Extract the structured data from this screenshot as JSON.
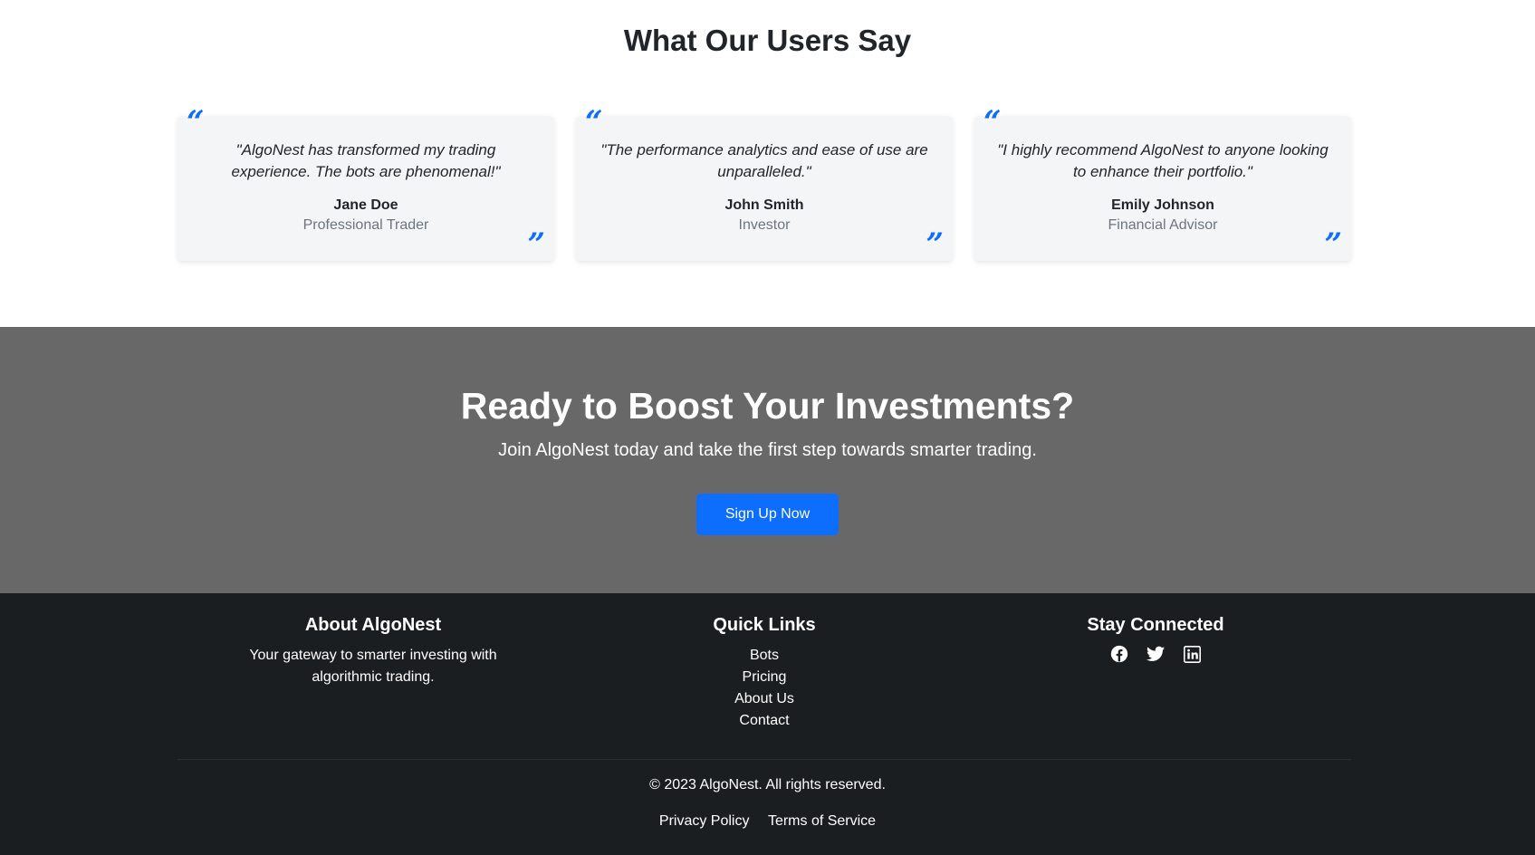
{
  "testimonials": {
    "title": "What Our Users Say",
    "items": [
      {
        "quote": "\"AlgoNest has transformed my trading experience. The bots are phenomenal!\"",
        "name": "Jane Doe",
        "role": "Professional Trader"
      },
      {
        "quote": "\"The performance analytics and ease of use are unparalleled.\"",
        "name": "John Smith",
        "role": "Investor"
      },
      {
        "quote": "\"I highly recommend AlgoNest to anyone looking to enhance their portfolio.\"",
        "name": "Emily Johnson",
        "role": "Financial Advisor"
      }
    ]
  },
  "cta": {
    "title": "Ready to Boost Your Investments?",
    "subtitle": "Join AlgoNest today and take the first step towards smarter trading.",
    "button_label": "Sign Up Now"
  },
  "footer": {
    "about": {
      "title": "About AlgoNest",
      "text": "Your gateway to smarter investing with algorithmic trading."
    },
    "links": {
      "title": "Quick Links",
      "items": [
        "Bots",
        "Pricing",
        "About Us",
        "Contact"
      ]
    },
    "social": {
      "title": "Stay Connected",
      "icons": [
        "facebook-icon",
        "twitter-icon",
        "linkedin-icon"
      ]
    },
    "copyright": "© 2023 AlgoNest. All rights reserved.",
    "legal": [
      "Privacy Policy",
      "Terms of Service"
    ]
  },
  "colors": {
    "accent": "#0d6efd",
    "cta_bg": "#686868",
    "footer_bg": "#1b1e21"
  }
}
